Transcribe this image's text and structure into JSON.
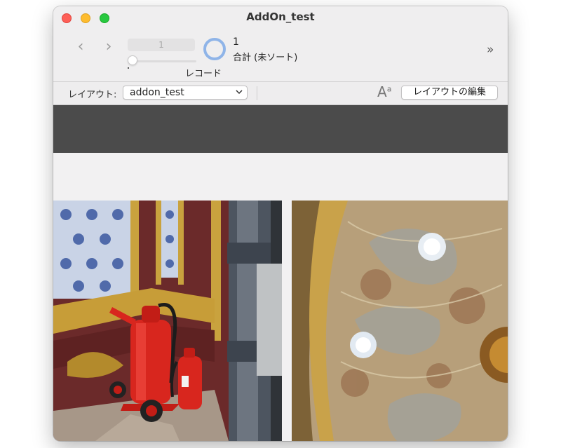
{
  "window": {
    "title": "AddOn_test"
  },
  "toolbar": {
    "record_number": "1",
    "record_label": "レコード",
    "found_count": "1",
    "found_status": "合計 (未ソート)",
    "prev_symbol": "‹",
    "next_symbol": "›",
    "more_symbol": "»"
  },
  "layout_bar": {
    "label": "レイアウト:",
    "selected_layout": "addon_test",
    "edit_button": "レイアウトの編集",
    "font_size_glyph": "A",
    "font_size_sup": "a"
  },
  "colors": {
    "close": "#fe5f57",
    "minimize": "#febc2e",
    "zoom": "#28c840",
    "header_band": "#4b4b4b",
    "ring": "#8fb4e8"
  },
  "icons": [
    "close-icon",
    "minimize-icon",
    "zoom-icon",
    "chevron-left-icon",
    "chevron-right-icon",
    "ring-icon",
    "double-chevron-right-icon",
    "chevron-down-icon",
    "font-size-icon"
  ]
}
